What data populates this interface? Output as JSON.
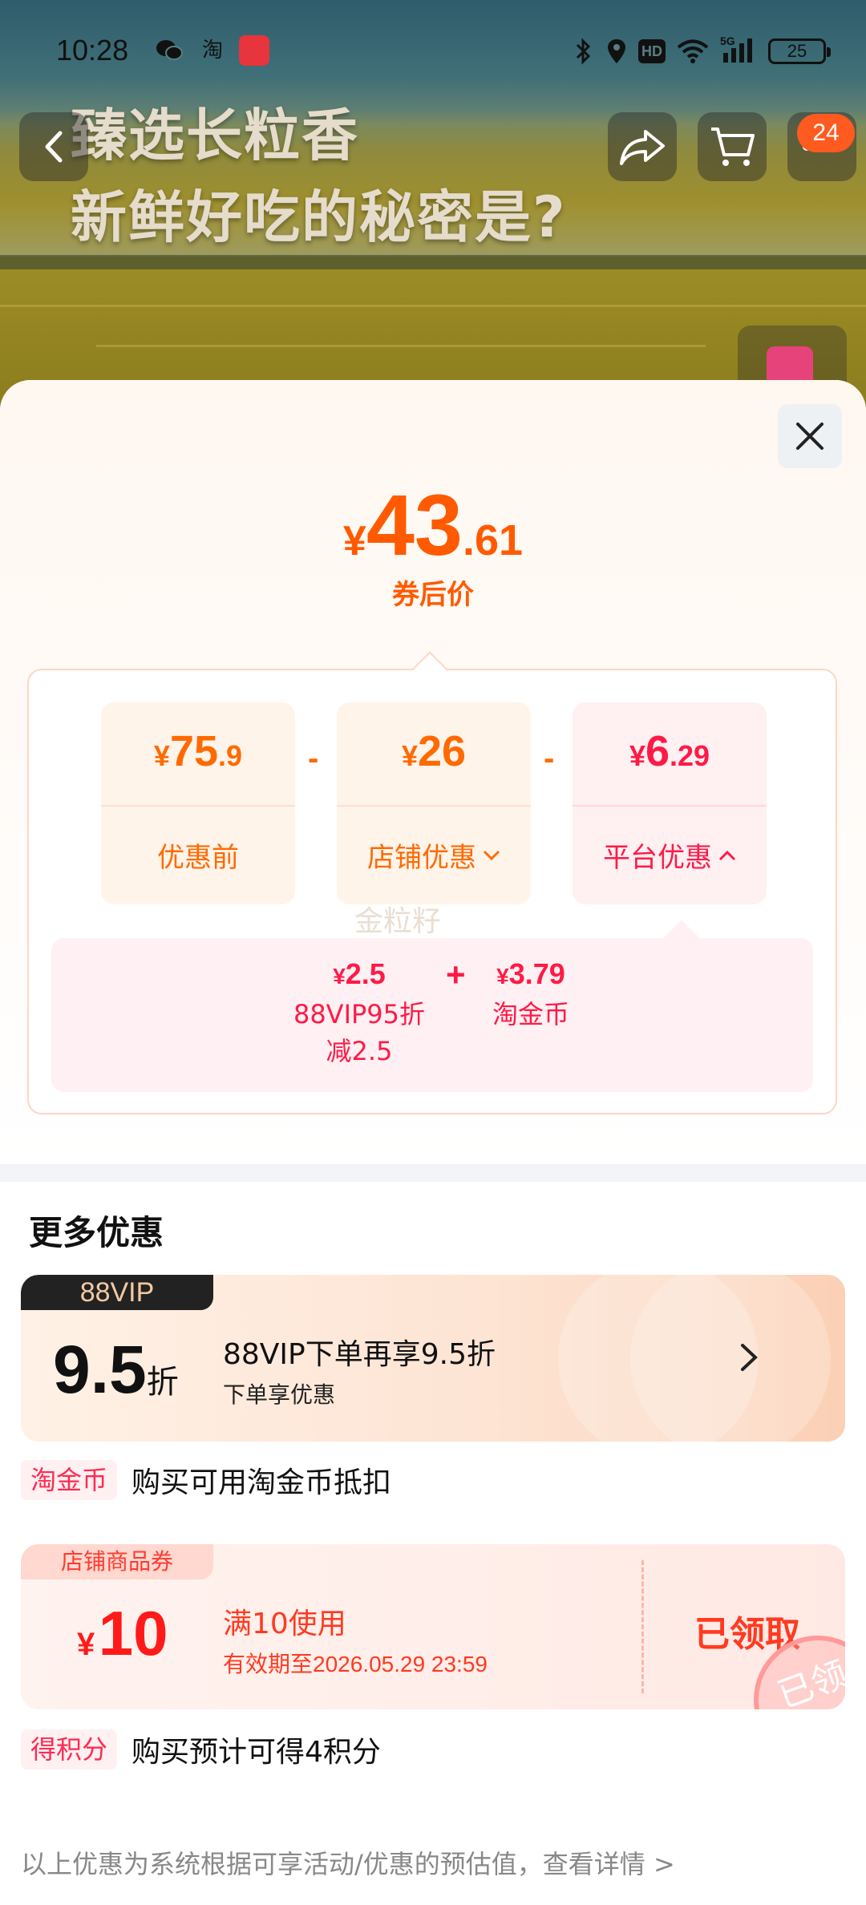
{
  "status_bar": {
    "time": "10:28",
    "app_icons": [
      "wechat-icon",
      "taobao-icon",
      "app-icon"
    ],
    "app_icon_taobao_text": "淘",
    "right_icons": [
      "bluetooth-icon",
      "location-icon",
      "hd-icon",
      "wifi-icon",
      "5g-signal-icon"
    ],
    "hd_text": "HD",
    "signal_text": "5G",
    "battery": "25"
  },
  "banner": {
    "title_line1": "臻选长粒香",
    "title_line2": "新鲜好吃的秘密是?",
    "cart_badge": "24"
  },
  "sheet": {
    "final_price": {
      "currency": "¥",
      "integer": "43",
      "decimal": ".61"
    },
    "final_label": "券后价",
    "breakdown": {
      "original": {
        "currency": "¥",
        "integer": "75",
        "decimal": ".9",
        "label": "优惠前"
      },
      "store": {
        "currency": "¥",
        "integer": "26",
        "decimal": "",
        "label": "店铺优惠"
      },
      "platform": {
        "currency": "¥",
        "integer": "6",
        "decimal": ".29",
        "label": "平台优惠"
      },
      "minus": "-",
      "watermark": "金粒籽"
    },
    "platform_detail": {
      "item1_value": "2.5",
      "item1_currency": "¥",
      "item1_name_line1": "88VIP95折",
      "item1_name_line2": "减2.5",
      "plus": "+",
      "item2_value": "3.79",
      "item2_currency": "¥",
      "item2_name": "淘金币"
    },
    "more_title": "更多优惠",
    "vip": {
      "tag": "88VIP",
      "discount": "9.5",
      "unit": "折",
      "title": "88VIP下单再享9.5折",
      "subtitle": "下单享优惠"
    },
    "coins": {
      "tag": "淘金币",
      "text": "购买可用淘金币抵扣"
    },
    "coupon": {
      "tag": "店铺商品券",
      "currency": "¥",
      "value": "10",
      "condition": "满10使用",
      "expiry": "有效期至2026.05.29 23:59",
      "button": "已领取",
      "stamp": "已领"
    },
    "points": {
      "tag": "得积分",
      "text": "购买预计可得4积分"
    },
    "footnote": "以上优惠为系统根据可享活动/优惠的预估值，查看详情 >"
  },
  "colors": {
    "accent_orange": "#ff5a00",
    "accent_red": "#ff1a46",
    "badge": "#ff5a1f"
  }
}
